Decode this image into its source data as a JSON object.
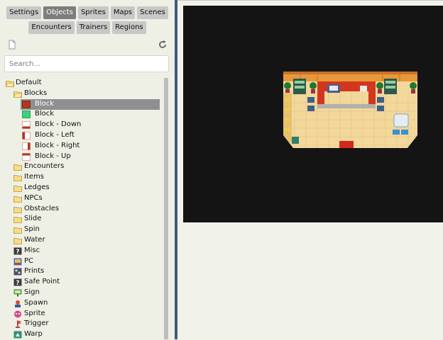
{
  "tabs_row1": [
    {
      "label": "Settings",
      "active": false
    },
    {
      "label": "Objects",
      "active": true
    },
    {
      "label": "Sprites",
      "active": false
    },
    {
      "label": "Maps",
      "active": false
    },
    {
      "label": "Scenes",
      "active": false
    }
  ],
  "tabs_row2": [
    {
      "label": "Encounters",
      "active": false
    },
    {
      "label": "Trainers",
      "active": false
    },
    {
      "label": "Regions",
      "active": false
    }
  ],
  "toolbar": {
    "new_icon": "new-file-icon",
    "refresh_icon": "refresh-icon"
  },
  "search": {
    "placeholder": "Search...",
    "value": ""
  },
  "tree": [
    {
      "label": "Default",
      "icon": "folder-open",
      "level": 0
    },
    {
      "label": "Blocks",
      "icon": "folder-open",
      "level": 1
    },
    {
      "label": "Block",
      "icon": "block-red",
      "level": 2,
      "selected": true
    },
    {
      "label": "Block",
      "icon": "block-green",
      "level": 2
    },
    {
      "label": "Block - Down",
      "icon": "block-down",
      "level": 2
    },
    {
      "label": "Block - Left",
      "icon": "block-left",
      "level": 2
    },
    {
      "label": "Block - Right",
      "icon": "block-right",
      "level": 2
    },
    {
      "label": "Block - Up",
      "icon": "block-up",
      "level": 2
    },
    {
      "label": "Encounters",
      "icon": "folder",
      "level": 1
    },
    {
      "label": "Items",
      "icon": "folder",
      "level": 1
    },
    {
      "label": "Ledges",
      "icon": "folder",
      "level": 1
    },
    {
      "label": "NPCs",
      "icon": "folder",
      "level": 1
    },
    {
      "label": "Obstacles",
      "icon": "folder",
      "level": 1
    },
    {
      "label": "Slide",
      "icon": "folder",
      "level": 1
    },
    {
      "label": "Spin",
      "icon": "folder",
      "level": 1
    },
    {
      "label": "Water",
      "icon": "folder",
      "level": 1
    },
    {
      "label": "Misc",
      "icon": "question",
      "level": 1
    },
    {
      "label": "PC",
      "icon": "pc",
      "level": 1
    },
    {
      "label": "Prints",
      "icon": "prints",
      "level": 1
    },
    {
      "label": "Safe Point",
      "icon": "question",
      "level": 1
    },
    {
      "label": "Sign",
      "icon": "sign",
      "level": 1
    },
    {
      "label": "Spawn",
      "icon": "spawn",
      "level": 1
    },
    {
      "label": "Sprite",
      "icon": "sprite",
      "level": 1
    },
    {
      "label": "Trigger",
      "icon": "trigger",
      "level": 1
    },
    {
      "label": "Warp",
      "icon": "warp",
      "level": 1
    }
  ],
  "colors": {
    "accent_divider": "#3b5c82",
    "canvas_bg": "#141414",
    "tab_active": "#7d7d7d",
    "tab_inactive": "#c8c8c8",
    "selection": "#8f8f8f"
  }
}
